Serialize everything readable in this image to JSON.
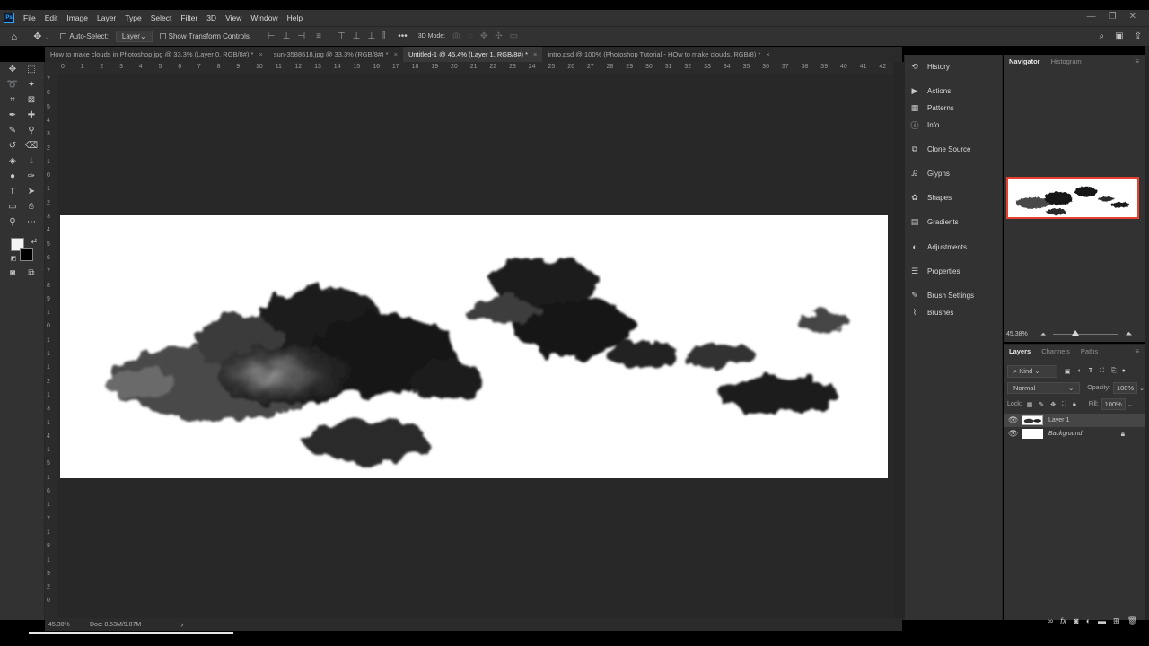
{
  "app": {
    "logo": "Ps",
    "menu": [
      "File",
      "Edit",
      "Image",
      "Layer",
      "Type",
      "Select",
      "Filter",
      "3D",
      "View",
      "Window",
      "Help"
    ],
    "window_controls": [
      "—",
      "❐",
      "✕"
    ]
  },
  "options_bar": {
    "auto_select_label": "Auto-Select:",
    "target_select": "Layer",
    "show_transform_label": "Show Transform Controls",
    "more_label": "•••",
    "mode_3d_label": "3D Mode:"
  },
  "tabs": [
    {
      "label": "How to make clouds in Photoshop.jpg @ 33.3% (Layer 0, RGB/8#) *",
      "active": false
    },
    {
      "label": "sun-3588618.jpg @ 33.3% (RGB/8#) *",
      "active": false
    },
    {
      "label": "Untitled-1 @ 45.4% (Layer 1, RGB/8#) *",
      "active": true
    },
    {
      "label": "intro.psd @ 100% (Photoshop Tutorial - HOw to make clouds, RGB/8) *",
      "active": false
    }
  ],
  "tab_close": "×",
  "ruler_h": [
    "0",
    "1",
    "2",
    "3",
    "4",
    "5",
    "6",
    "7",
    "8",
    "9",
    "10",
    "11",
    "12",
    "13",
    "14",
    "15",
    "16",
    "17",
    "18",
    "19",
    "20",
    "21",
    "22",
    "23",
    "24",
    "25",
    "26",
    "27",
    "28",
    "29",
    "30",
    "31",
    "32",
    "33",
    "34",
    "35",
    "36",
    "37",
    "38",
    "39",
    "40",
    "41",
    "42"
  ],
  "ruler_v": [
    "7",
    "6",
    "5",
    "4",
    "3",
    "2",
    "1",
    "0",
    "1",
    "2",
    "3",
    "4",
    "5",
    "6",
    "7",
    "8",
    "9",
    "1",
    "0",
    "1",
    "1",
    "1",
    "2",
    "1",
    "3",
    "1",
    "4",
    "1",
    "5",
    "1",
    "6",
    "1",
    "7",
    "1",
    "8",
    "1",
    "9",
    "2",
    "0"
  ],
  "status": {
    "zoom": "45.38%",
    "doc": "Doc: 8.53M/9.87M",
    "arrow": "›"
  },
  "dock_panels": [
    {
      "name": "History",
      "icon": "history-icon",
      "glyph": "⟲"
    },
    {
      "name": "Actions",
      "icon": "actions-icon",
      "glyph": "▶"
    },
    {
      "name": "Patterns",
      "icon": "patterns-icon",
      "glyph": "▦"
    },
    {
      "name": "Info",
      "icon": "info-icon",
      "glyph": "ⓘ"
    },
    {
      "name": "Clone Source",
      "icon": "clone-source-icon",
      "glyph": "⧉"
    },
    {
      "name": "Glyphs",
      "icon": "glyphs-icon",
      "glyph": "Ꭿ"
    },
    {
      "name": "Shapes",
      "icon": "shapes-icon",
      "glyph": "✿"
    },
    {
      "name": "Gradients",
      "icon": "gradients-icon",
      "glyph": "▤"
    },
    {
      "name": "Adjustments",
      "icon": "adjustments-icon",
      "glyph": "◐"
    },
    {
      "name": "Properties",
      "icon": "properties-icon",
      "glyph": "☰"
    },
    {
      "name": "Brush Settings",
      "icon": "brush-settings-icon",
      "glyph": "✎"
    },
    {
      "name": "Brushes",
      "icon": "brushes-icon",
      "glyph": "⌇"
    }
  ],
  "navigator": {
    "tabs": [
      "Navigator",
      "Histogram"
    ],
    "zoom": "45.38%",
    "slider_fraction": 0.34
  },
  "layers": {
    "tabs": [
      "Layers",
      "Channels",
      "Paths"
    ],
    "filter_label": "Kind",
    "blend_mode": "Normal",
    "opacity_label": "Opacity:",
    "opacity": "100%",
    "lock_label": "Lock:",
    "fill_label": "Fill:",
    "fill": "100%",
    "items": [
      {
        "name": "Layer 1",
        "visible": true,
        "selected": true
      },
      {
        "name": "Background",
        "visible": true,
        "selected": false,
        "locked": true
      }
    ]
  },
  "colors": {
    "ui_bg": "#323232",
    "canvas_bg": "#282828",
    "accent_nav": "#e6402f",
    "ps_blue": "#31a8ff"
  }
}
